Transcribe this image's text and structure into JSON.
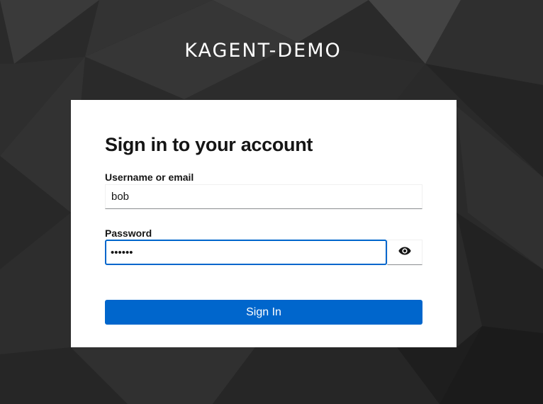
{
  "realm": {
    "title": "KAGENT-DEMO"
  },
  "login": {
    "heading": "Sign in to your account",
    "username_label": "Username or email",
    "username_value": "bob",
    "password_label": "Password",
    "password_value": "••••••",
    "show_password_icon": "eye-icon",
    "submit_label": "Sign In"
  },
  "colors": {
    "primary": "#0066cc",
    "background": "#262626",
    "card": "#ffffff",
    "text": "#151515"
  }
}
